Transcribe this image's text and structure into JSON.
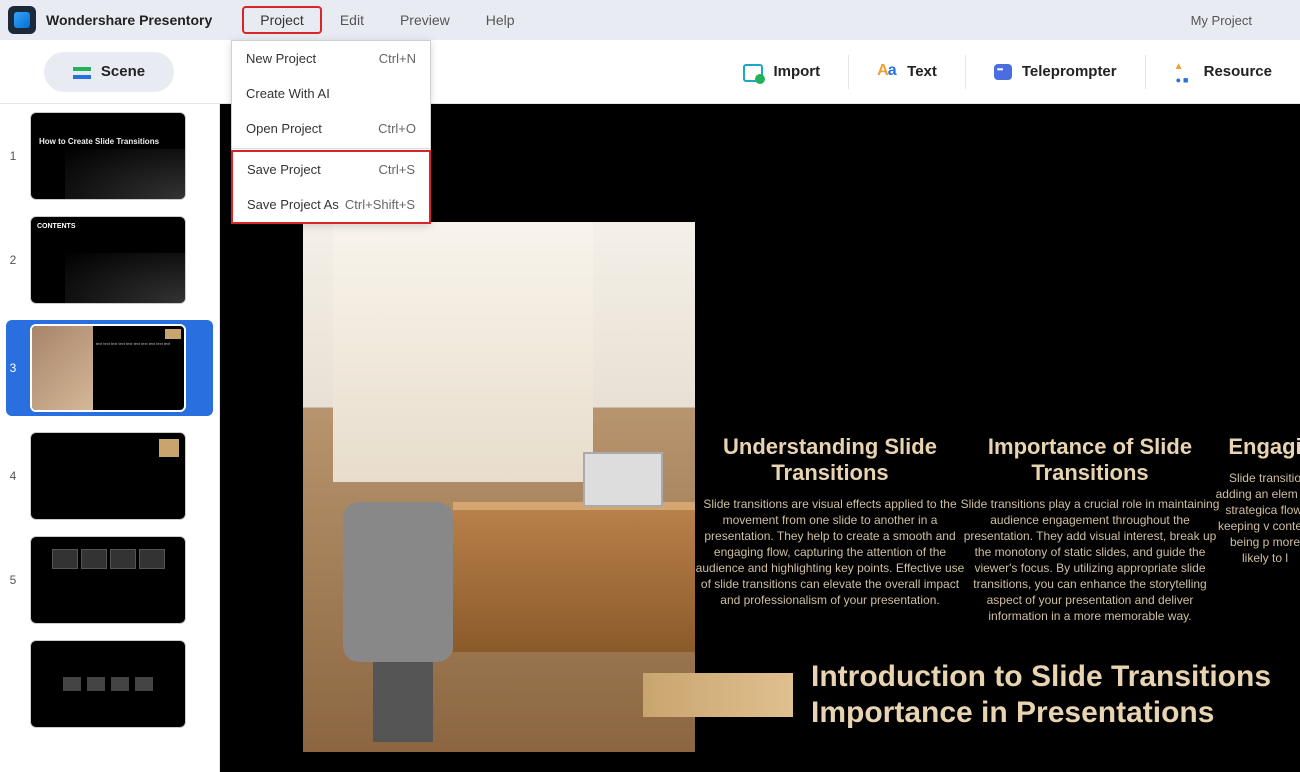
{
  "app": {
    "name": "Wondershare Presentory",
    "project_name": "My Project"
  },
  "menubar": {
    "project": "Project",
    "edit": "Edit",
    "preview": "Preview",
    "help": "Help"
  },
  "dropdown": {
    "new_project": "New Project",
    "new_project_sc": "Ctrl+N",
    "create_ai": "Create With AI",
    "open_project": "Open Project",
    "open_project_sc": "Ctrl+O",
    "save_project": "Save Project",
    "save_project_sc": "Ctrl+S",
    "save_as": "Save Project As",
    "save_as_sc": "Ctrl+Shift+S"
  },
  "toolbar": {
    "scene": "Scene",
    "import": "Import",
    "text": "Text",
    "teleprompter": "Teleprompter",
    "resource": "Resource"
  },
  "thumbs": {
    "n1": "1",
    "n2": "2",
    "n3": "3",
    "n4": "4",
    "n5": "5",
    "slide1_title": "How to Create Slide Transitions",
    "slide2_title": "CONTENTS"
  },
  "canvas": {
    "col1_title": "Understanding Slide Transitions",
    "col1_body": "Slide transitions are visual effects applied to the movement from one slide to another in a presentation. They help to create a smooth and engaging flow, capturing the attention of the audience and highlighting key points. Effective use of slide transitions can elevate the overall impact and professionalism of your presentation.",
    "col2_title": "Importance of Slide Transitions",
    "col2_body": "Slide transitions play a crucial role in maintaining audience engagement throughout the presentation. They add visual interest, break up the monotony of static slides, and guide the viewer's focus. By utilizing appropriate slide transitions, you can enhance the storytelling aspect of your presentation and deliver information in a more memorable way.",
    "col3_title": "Engagi",
    "col3_body": "Slide transitio adding an elem ed strategica flow, keeping v content being p more likely to l",
    "intro_line1": "Introduction to Slide Transitions",
    "intro_line2": "Importance in Presentations"
  }
}
